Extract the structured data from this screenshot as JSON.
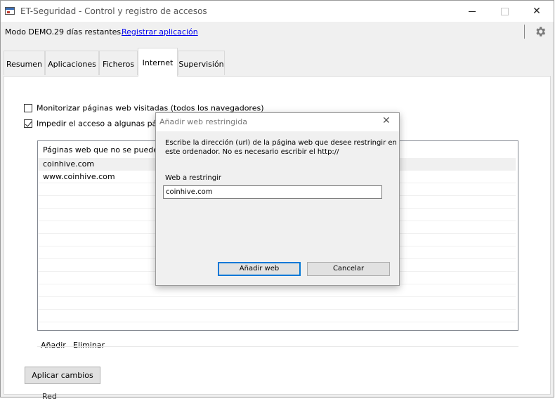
{
  "window": {
    "title": "ET-Seguridad - Control y registro de accesos",
    "controls": {
      "minimize_icon": "minimize-icon",
      "maximize_icon": "maximize-icon",
      "close_icon": "close-icon"
    }
  },
  "demo_bar": {
    "text": "Modo DEMO.29 días restantes.",
    "register_link": "Registrar aplicación",
    "settings_icon": "gear-icon"
  },
  "tabs": [
    {
      "label": "Resumen",
      "active": false
    },
    {
      "label": "Aplicaciones",
      "active": false
    },
    {
      "label": "Ficheros",
      "active": false
    },
    {
      "label": "Internet",
      "active": true
    },
    {
      "label": "Supervisión",
      "active": false
    }
  ],
  "internet": {
    "monitor_checkbox": {
      "label": "Monitorizar páginas web visitadas (todos los navegadores)",
      "checked": false
    },
    "block_checkbox": {
      "label": "Impedir el acceso a algunas págin",
      "checked": true
    },
    "list": {
      "header": "Páginas web que no se pueden",
      "items": [
        "coinhive.com",
        "www.coinhive.com"
      ]
    },
    "add_label": "Añadir",
    "remove_label": "Eliminar",
    "apply_label": "Aplicar cambios"
  },
  "taskbar_peek_text": "Red",
  "dialog": {
    "title": "Añadir web restringida",
    "description": "Escribe la dirección (url) de la página web que desee restringir en este ordenador. No es necesario escribir el http://",
    "field_label": "Web a restringir",
    "field_value": "coinhive.com",
    "add_button": "Añadir web",
    "cancel_button": "Cancelar"
  }
}
